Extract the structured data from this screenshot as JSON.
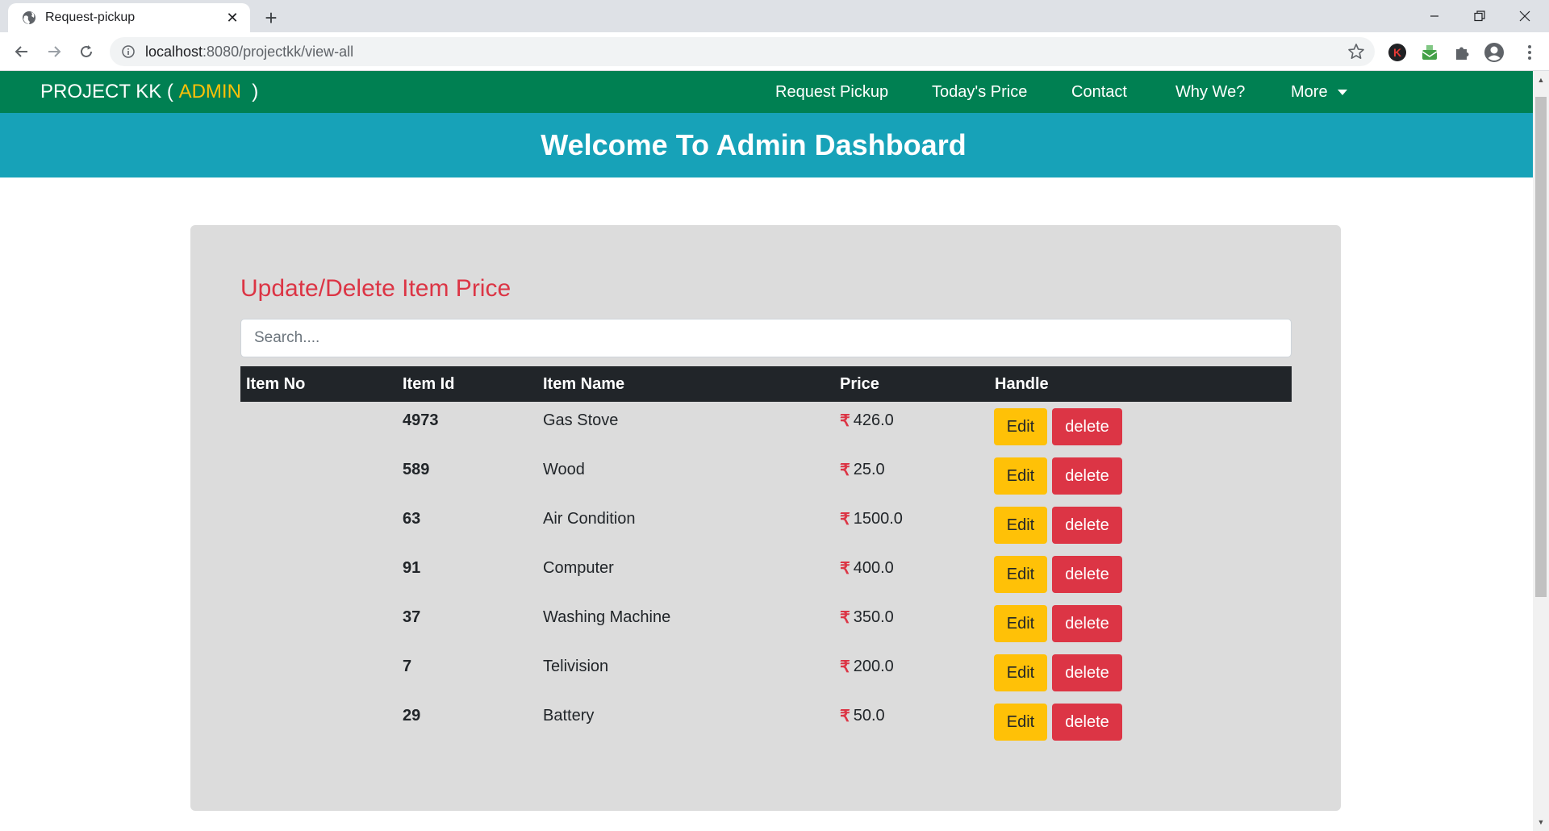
{
  "browser": {
    "tab_title": "Request-pickup",
    "url_host": "localhost",
    "url_rest": ":8080/projectkk/view-all",
    "new_tab": "+"
  },
  "navbar": {
    "brand_prefix": "PROJECT KK ( ",
    "brand_admin": "ADMIN",
    "brand_suffix": "  )",
    "links": [
      "Request Pickup",
      "Today's Price",
      "Contact",
      "Why We?",
      "More"
    ]
  },
  "banner": {
    "title": "Welcome To Admin Dashboard"
  },
  "panel": {
    "title": "Update/Delete Item Price",
    "search_placeholder": "Search....",
    "columns": [
      "Item No",
      "Item Id",
      "Item Name",
      "Price",
      "Handle"
    ],
    "currency": "₹",
    "edit_label": "Edit",
    "delete_label": "delete",
    "rows": [
      {
        "item_no": "",
        "item_id": "4973",
        "name": "Gas Stove",
        "price": "426.0"
      },
      {
        "item_no": "",
        "item_id": "589",
        "name": "Wood",
        "price": "25.0"
      },
      {
        "item_no": "",
        "item_id": "63",
        "name": "Air Condition",
        "price": "1500.0"
      },
      {
        "item_no": "",
        "item_id": "91",
        "name": "Computer",
        "price": "400.0"
      },
      {
        "item_no": "",
        "item_id": "37",
        "name": "Washing Machine",
        "price": "350.0"
      },
      {
        "item_no": "",
        "item_id": "7",
        "name": "Telivision",
        "price": "200.0"
      },
      {
        "item_no": "",
        "item_id": "29",
        "name": "Battery",
        "price": "50.0"
      }
    ]
  },
  "colors": {
    "navbar": "#008052",
    "banner": "#17a2b8",
    "admin_accent": "#ffc107",
    "title_red": "#dc3545",
    "edit_button": "#ffc107",
    "delete_button": "#dc3545",
    "table_header": "#212529"
  }
}
